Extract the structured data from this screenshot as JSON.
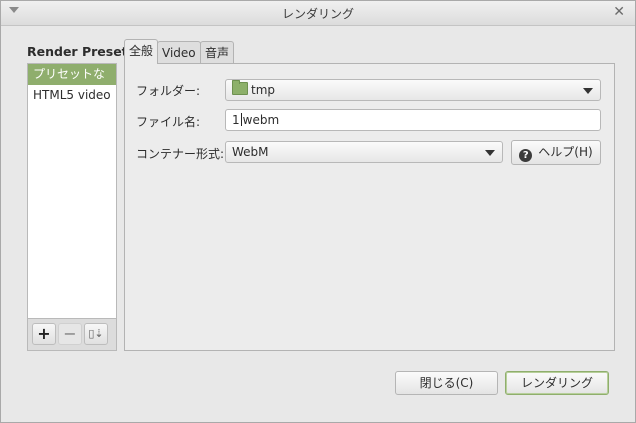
{
  "window": {
    "title": "レンダリング"
  },
  "presets": {
    "title": "Render Preset",
    "items": [
      {
        "label": "プリセットなし",
        "selected": true
      },
      {
        "label": "HTML5 video",
        "selected": false
      }
    ],
    "toolbar": {
      "add": "+",
      "remove": "−",
      "import": "▯⇣"
    }
  },
  "tabs": [
    {
      "label": "全般",
      "active": true
    },
    {
      "label": "Video",
      "active": false
    },
    {
      "label": "音声",
      "active": false
    }
  ],
  "general": {
    "folder_label": "フォルダー:",
    "folder_value": "tmp",
    "filename_label": "ファイル名:",
    "filename_before_caret": "1",
    "filename_after_caret": "webm",
    "container_label": "コンテナー形式:",
    "container_value": "WebM",
    "help_label": "ヘルプ(H)"
  },
  "footer": {
    "close_label": "閉じる(C)",
    "render_label": "レンダリング"
  },
  "colors": {
    "selection": "#8fae6d"
  }
}
